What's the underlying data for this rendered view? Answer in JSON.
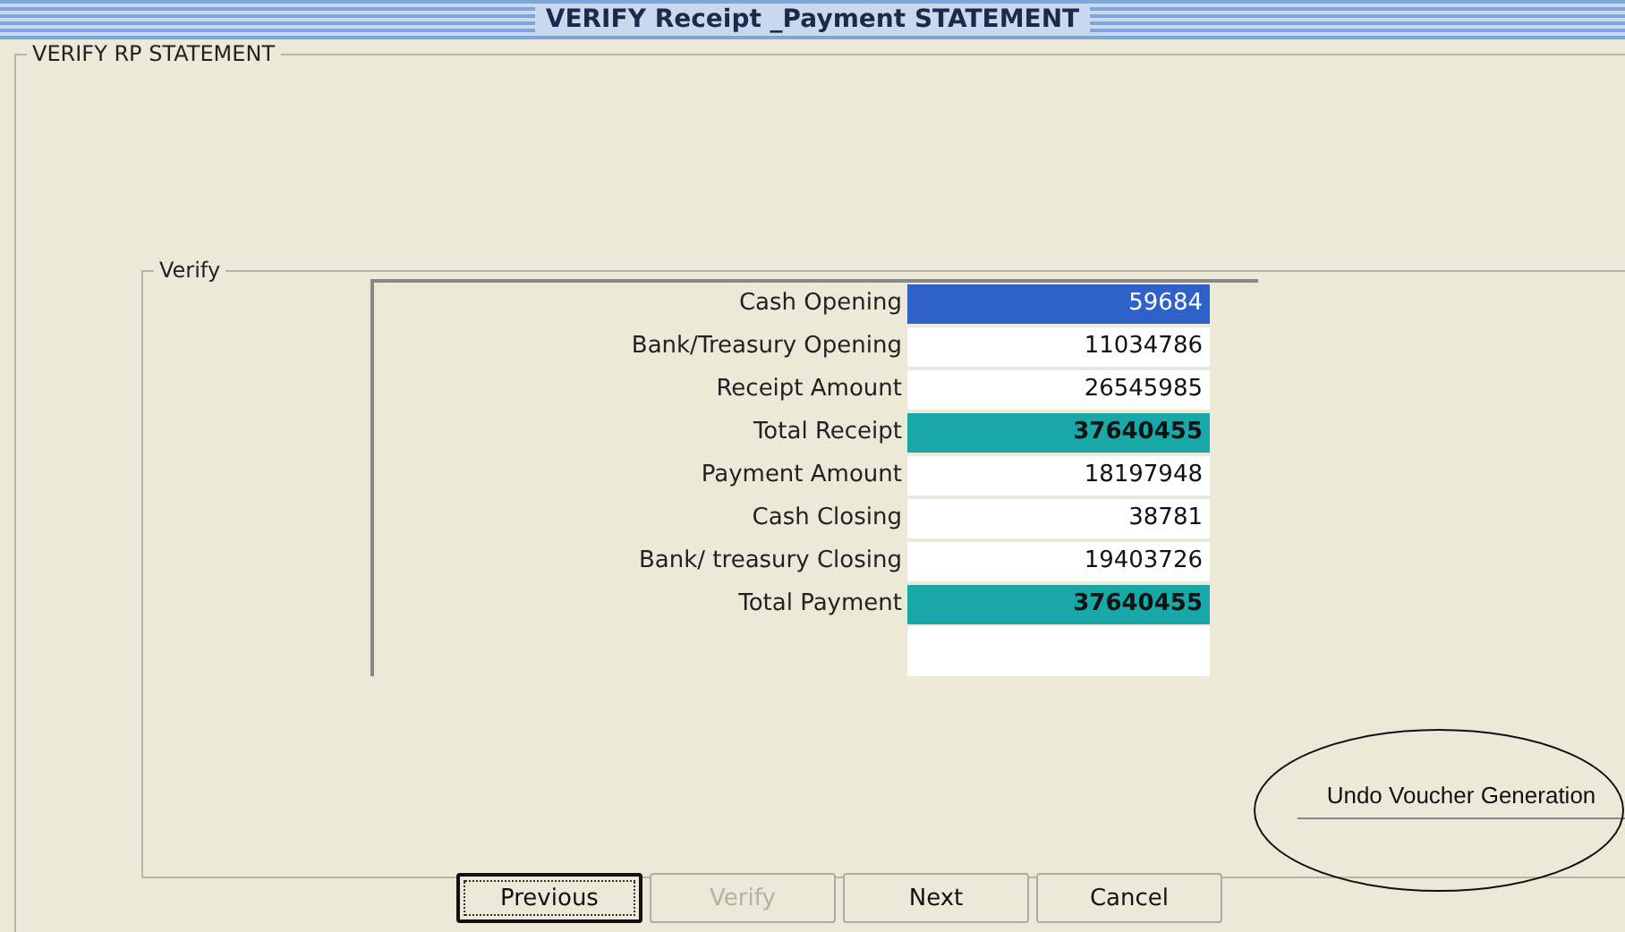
{
  "window": {
    "title": "VERIFY Receipt _Payment STATEMENT"
  },
  "outer_group": {
    "label": "VERIFY RP STATEMENT"
  },
  "inner_group": {
    "label": "Verify"
  },
  "rows": [
    {
      "label": "Cash Opening",
      "value": "59684",
      "selected": true,
      "total": false
    },
    {
      "label": "Bank/Treasury Opening",
      "value": "11034786",
      "selected": false,
      "total": false
    },
    {
      "label": "Receipt Amount",
      "value": "26545985",
      "selected": false,
      "total": false
    },
    {
      "label": "Total Receipt",
      "value": "37640455",
      "selected": false,
      "total": true
    },
    {
      "label": "Payment Amount",
      "value": "18197948",
      "selected": false,
      "total": false
    },
    {
      "label": "Cash Closing",
      "value": "38781",
      "selected": false,
      "total": false
    },
    {
      "label": "Bank/ treasury Closing",
      "value": "19403726",
      "selected": false,
      "total": false
    },
    {
      "label": "Total Payment",
      "value": "37640455",
      "selected": false,
      "total": true
    }
  ],
  "undo_button": {
    "label": "Undo Voucher Generation",
    "circled": true
  },
  "buttons": [
    {
      "label": "Previous",
      "disabled": false,
      "focused": true
    },
    {
      "label": "Verify",
      "disabled": true,
      "focused": false
    },
    {
      "label": "Next",
      "disabled": false,
      "focused": false
    },
    {
      "label": "Cancel",
      "disabled": false,
      "focused": false
    }
  ]
}
